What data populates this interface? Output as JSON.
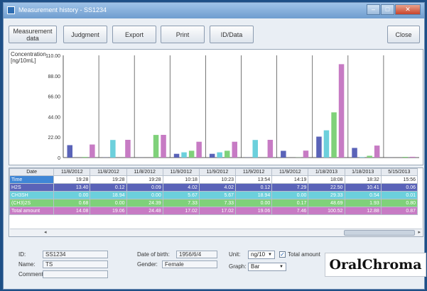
{
  "window": {
    "title": "Measurement history - SS1234",
    "minimize_glyph": "–",
    "maximize_glyph": "□",
    "close_glyph": "✕"
  },
  "toolbar": {
    "measurement_data_line1": "Measurement",
    "measurement_data_line2": "data",
    "judgment": "Judgment",
    "export": "Export",
    "print": "Print",
    "id_data": "ID/Data",
    "close": "Close"
  },
  "chart_data": {
    "type": "bar",
    "ylabel": "Concentration\n[ng/10mL]",
    "ylim": [
      0,
      110
    ],
    "y_ticks": [
      "110.00",
      "88.00",
      "66.00",
      "44.00",
      "22.00",
      "0"
    ],
    "categories": [
      "11/8/2012 19:28",
      "11/8/2012 19:28",
      "11/8/2012 19:28",
      "11/9/2012 10:18",
      "11/9/2012 10:23",
      "11/9/2012 13:54",
      "11/9/2012 14:19",
      "1/18/2013 18:08",
      "1/18/2013 18:32",
      "5/15/2013 15:56"
    ],
    "series": [
      {
        "name": "H2S",
        "color": "#5a63b8",
        "values": [
          13.4,
          0.12,
          0.09,
          4.02,
          4.02,
          0.12,
          7.29,
          22.5,
          10.41,
          0.06
        ]
      },
      {
        "name": "CH3SH",
        "color": "#6cd0dc",
        "values": [
          0.0,
          18.94,
          0.0,
          5.67,
          5.67,
          18.94,
          0.0,
          29.33,
          0.54,
          0.01
        ]
      },
      {
        "name": "(CH3)2S",
        "color": "#7fd17a",
        "values": [
          0.68,
          0.0,
          24.39,
          7.33,
          7.33,
          0.0,
          0.17,
          48.69,
          1.93,
          0.8
        ]
      },
      {
        "name": "Total amount",
        "color": "#c77bc4",
        "values": [
          14.08,
          19.06,
          24.48,
          17.02,
          17.02,
          19.06,
          7.46,
          100.52,
          12.88,
          0.87
        ]
      }
    ]
  },
  "table": {
    "header_label": "Date",
    "dates": [
      "11/8/2012",
      "11/8/2012",
      "11/8/2012",
      "11/9/2012",
      "11/9/2012",
      "11/9/2012",
      "11/9/2012",
      "1/18/2013",
      "1/18/2013",
      "5/15/2013"
    ],
    "rows": [
      {
        "label": "Time",
        "color": "#3f86d6",
        "cells": [
          "19:28",
          "19:28",
          "19:28",
          "10:18",
          "10:23",
          "13:54",
          "14:19",
          "18:08",
          "18:32",
          "15:56"
        ]
      },
      {
        "label": "H2S",
        "color": "#5a63b8",
        "cells": [
          "13.40",
          "0.12",
          "0.09",
          "4.02",
          "4.02",
          "0.12",
          "7.29",
          "22.50",
          "10.41",
          "0.06"
        ]
      },
      {
        "label": "CH3SH",
        "color": "#6cd0dc",
        "cells": [
          "0.00",
          "18.94",
          "0.00",
          "5.67",
          "5.67",
          "18.94",
          "0.00",
          "29.33",
          "0.54",
          "0.01"
        ]
      },
      {
        "label": "(CH3)2S",
        "color": "#7fd17a",
        "cells": [
          "0.68",
          "0.00",
          "24.39",
          "7.33",
          "7.33",
          "0.00",
          "0.17",
          "48.69",
          "1.93",
          "0.80"
        ]
      },
      {
        "label": "Total amount",
        "color": "#c77bc4",
        "cells": [
          "14.08",
          "19.06",
          "24.48",
          "17.02",
          "17.02",
          "19.06",
          "7.46",
          "100.52",
          "12.88",
          "0.87"
        ]
      }
    ]
  },
  "patient": {
    "id_label": "ID:",
    "id_value": "SS1234",
    "name_label": "Name:",
    "name_value": "TS",
    "comment_label": "Comment:",
    "comment_value": "",
    "dob_label": "Date of birth:",
    "dob_value": "1956/6/4",
    "gender_label": "Gender:",
    "gender_value": "Female"
  },
  "options": {
    "unit_label": "Unit:",
    "unit_value": "ng/10",
    "total_amount_label": "Total amount",
    "total_amount_checked": true,
    "graph_label": "Graph:",
    "graph_value": "Bar"
  },
  "logo": "OralChroma",
  "scroll": {
    "left_arrow": "◂",
    "right_arrow": "▸"
  }
}
